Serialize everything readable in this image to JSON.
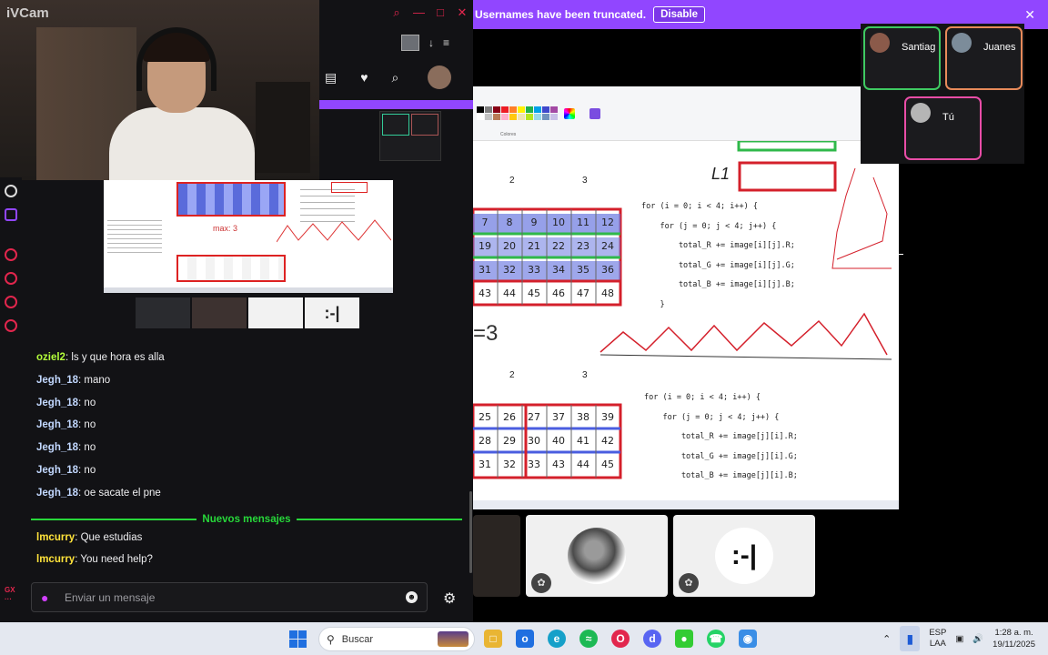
{
  "webcam": {
    "title": "iVCam"
  },
  "browser": {
    "window_controls": [
      "⌕",
      "—",
      "□",
      "✕"
    ],
    "tabs_icons": [
      "↓",
      "≡"
    ],
    "toolbar_icons": [
      "▤",
      "♥",
      "⌕"
    ]
  },
  "stream_preview": {
    "annotation": "max: 3",
    "tile_face": ":-|"
  },
  "chat": {
    "messages_before": [
      {
        "user": "oziel2",
        "text": "ls y que hora es alla",
        "color": "#b4ff3a"
      },
      {
        "user": "Jegh_18",
        "text": "mano",
        "color": "#c2d8ff"
      },
      {
        "user": "Jegh_18",
        "text": "no",
        "color": "#c2d8ff"
      },
      {
        "user": "Jegh_18",
        "text": "no",
        "color": "#c2d8ff"
      },
      {
        "user": "Jegh_18",
        "text": "no",
        "color": "#c2d8ff"
      },
      {
        "user": "Jegh_18",
        "text": "no",
        "color": "#c2d8ff"
      },
      {
        "user": "Jegh_18",
        "text": "oe sacate el pne",
        "color": "#c2d8ff"
      }
    ],
    "separator_label": "Nuevos mensajes",
    "messages_after": [
      {
        "user": "lmcurry",
        "text": "Que estudias",
        "color": "#ffe33a"
      },
      {
        "user": "lmcurry",
        "text": "You need help?",
        "color": "#ffe33a"
      }
    ],
    "input_placeholder": "Enviar un mensaje"
  },
  "banner": {
    "text": "Usernames have been truncated.",
    "button": "Disable",
    "close": "✕"
  },
  "whiteboard": {
    "label_l1": "L1",
    "col_labels": [
      "2",
      "3"
    ],
    "eq": "=3",
    "code_top": "for (i = 0; i < 4; i++) {\n    for (j = 0; j < 4; j++) {\n        total_R += image[i][j].R;\n        total_G += image[i][j].G;\n        total_B += image[i][j].B;\n    }",
    "code_bottom": "for (i = 0; i < 4; i++) {\n    for (j = 0; j < 4; j++) {\n        total_R += image[j][i].R;\n        total_G += image[j][i].G;\n        total_B += image[j][i].B;",
    "grid_top_rows": [
      [
        "7",
        "8",
        "9",
        "10",
        "11",
        "12"
      ],
      [
        "19",
        "20",
        "21",
        "22",
        "23",
        "24"
      ],
      [
        "31",
        "32",
        "33",
        "34",
        "35",
        "36"
      ],
      [
        "43",
        "44",
        "45",
        "46",
        "47",
        "48"
      ]
    ],
    "grid_bottom_rows": [
      [
        "25",
        "26",
        "27",
        "37",
        "38",
        "39"
      ],
      [
        "28",
        "29",
        "30",
        "40",
        "41",
        "42"
      ],
      [
        "31",
        "32",
        "33",
        "43",
        "44",
        "45"
      ]
    ],
    "toolbar_labels": [
      "Colores",
      "Editar colores",
      "Editar con Paint 3D"
    ]
  },
  "participants": [
    {
      "name": "Santiag",
      "border": "#3fca62",
      "avatar": "#8b5a4a"
    },
    {
      "name": "Juanes",
      "border": "#e78a5a",
      "avatar": "#7c8c9a"
    },
    {
      "name": "Tú",
      "border": "#e94da7",
      "avatar": "#b5b5b5"
    }
  ],
  "taskbar": {
    "search_placeholder": "Buscar",
    "lang_top": "ESP",
    "lang_bottom": "LAA",
    "time": "1:28 a. m.",
    "date": "19/11/2025"
  },
  "colors": {
    "accent_purple": "#9146ff",
    "gx_red": "#e2264d",
    "new_msgs_green": "#27d83a"
  }
}
